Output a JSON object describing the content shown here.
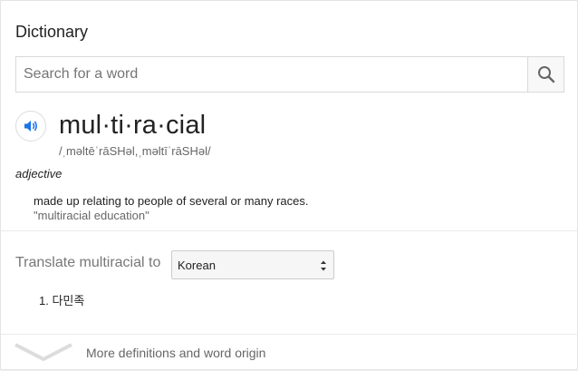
{
  "dictionary": {
    "title": "Dictionary",
    "search": {
      "placeholder": "Search for a word",
      "value": "",
      "icon": "search-icon"
    },
    "entry": {
      "headword": "mul·ti·ra·cial",
      "phonetic": "/ˌməltēˈrāSHəl,ˌməltīˈrāSHəl/",
      "part_of_speech": "adjective",
      "definition": "made up relating to people of several or many races.",
      "example": "\"multiracial education\"",
      "audio_icon": "speaker-icon"
    },
    "translate": {
      "label": "Translate multiracial to",
      "selected_language": "Korean",
      "results": [
        "1. 다민족"
      ]
    },
    "more": {
      "label": "More definitions and word origin",
      "icon": "chevron-down-icon"
    }
  },
  "colors": {
    "accent_blue": "#1a73e8",
    "text": "#222222",
    "muted": "#666666"
  }
}
